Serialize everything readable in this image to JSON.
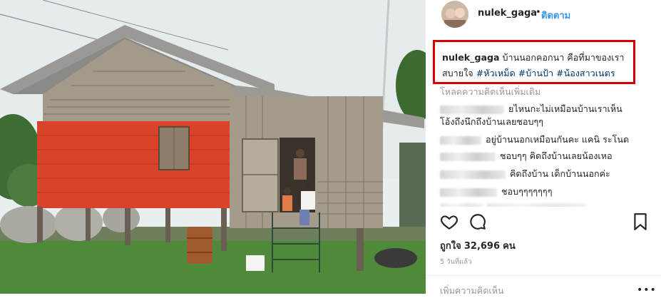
{
  "post": {
    "username": "nulek_gaga",
    "separator": "•",
    "follow_label": "ติดตาม"
  },
  "caption": {
    "username": "nulek_gaga",
    "line1_text": "บ้านนอกคอกนา คือที่มาของเรา",
    "line2_text": "สบายใจ",
    "hashtags": [
      "#หัวเหม็ด",
      "#บ้านป้า",
      "#น้องสาวเนตร"
    ]
  },
  "comments": {
    "load_more": "โหลดความคิดเห็นเพิ่มเติม",
    "items": [
      {
        "text": "ยไหนกะไม่เหมือนบ้านเราเห็น"
      },
      {
        "text": "โอ้งถึงนึกถึงบ้านเลยชอบๆๆ"
      },
      {
        "text": "อยู่บ้านนอกเหมือนกันคะ แคนิ ระโนด"
      },
      {
        "text": "ชอบๆๆ คิดถึงบ้านเลยน้องเหอ"
      },
      {
        "text": "คิดถึงบ้าน เด็กบ้านนอกค่ะ"
      },
      {
        "text": "ชอบๆๆๆๆๆๆๆ"
      }
    ]
  },
  "actions": {
    "like_icon": "heart-icon",
    "comment_icon": "speech-bubble-icon",
    "save_icon": "bookmark-icon"
  },
  "likes": {
    "label": "ถูกใจ",
    "count": "32,696",
    "unit": "คน"
  },
  "time_ago": "5 วันที่แล้ว",
  "add_comment_placeholder": "เพิ่มความคิดเห็น",
  "more_options": "•••",
  "colors": {
    "highlight_box": "#d50000",
    "follow": "#3897f0",
    "hashtag": "#003569"
  }
}
